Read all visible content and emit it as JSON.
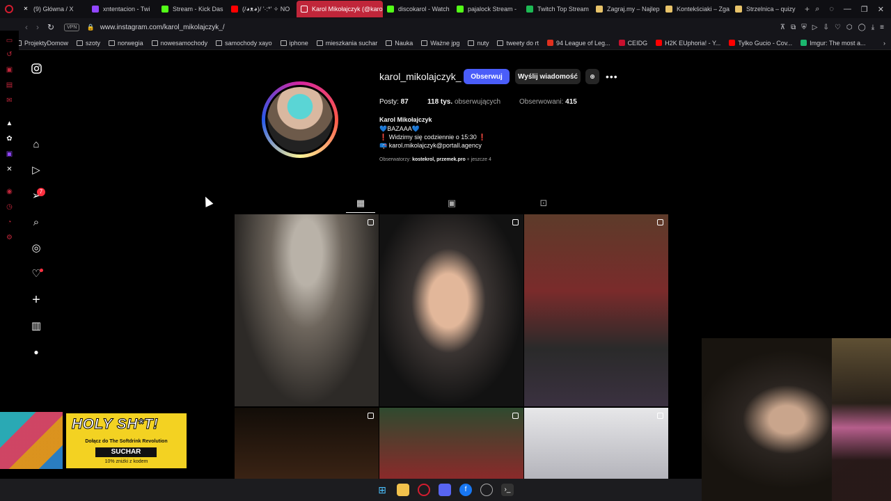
{
  "browser": {
    "tabs": [
      {
        "label": "(9) Główna / X",
        "icon": "x-icon",
        "color": "#ffffff"
      },
      {
        "label": "xntentacion - Twi",
        "icon": "twitch-icon",
        "color": "#9146ff"
      },
      {
        "label": "Stream - Kick Das",
        "icon": "kick-icon",
        "color": "#53fc18"
      },
      {
        "label": "(/◕ᴥ◕)/ '·:*' ✧ NO",
        "icon": "youtube-icon",
        "color": "#ff0000"
      },
      {
        "label": "Karol Mikołajczyk (@karo",
        "icon": "instagram-icon",
        "color": "#ffffff",
        "active": true
      },
      {
        "label": "discokarol - Watch",
        "icon": "kick-icon",
        "color": "#53fc18"
      },
      {
        "label": "pajalock Stream -",
        "icon": "kick-icon",
        "color": "#53fc18"
      },
      {
        "label": "Twitch Top Stream",
        "icon": "twitchtracker-icon",
        "color": "#1db954"
      },
      {
        "label": "Zagraj.my – Najlep",
        "icon": "trophy-icon",
        "color": "#e8c36a"
      },
      {
        "label": "Kontekściaki – Zga",
        "icon": "trophy-icon",
        "color": "#e8c36a"
      },
      {
        "label": "Strzelnica – quizy",
        "icon": "trophy-icon",
        "color": "#e8c36a"
      }
    ],
    "url": "www.instagram.com/karol_mikolajczyk_/",
    "vpn": "VPN",
    "bookmarks": [
      {
        "label": "ProjektyDomow",
        "type": "folder"
      },
      {
        "label": "szoty",
        "type": "folder"
      },
      {
        "label": "norwegia",
        "type": "folder"
      },
      {
        "label": "nowesamochody",
        "type": "folder"
      },
      {
        "label": "samochody xayo",
        "type": "folder"
      },
      {
        "label": "iphone",
        "type": "folder"
      },
      {
        "label": "mieszkania suchar",
        "type": "folder"
      },
      {
        "label": "Nauka",
        "type": "folder"
      },
      {
        "label": "Ważne jpg",
        "type": "folder"
      },
      {
        "label": "nuty",
        "type": "folder"
      },
      {
        "label": "tweety do rt",
        "type": "folder"
      },
      {
        "label": "94 League of Leg...",
        "type": "site",
        "color": "#e0301e"
      },
      {
        "label": "CEIDG",
        "type": "site",
        "color": "#c8102e"
      },
      {
        "label": "H2K EUphoria! - Y...",
        "type": "site",
        "color": "#ff0000"
      },
      {
        "label": "Tylko Gucio - Cov...",
        "type": "site",
        "color": "#ff0000"
      },
      {
        "label": "Imgur: The most a...",
        "type": "site",
        "color": "#1bb76e"
      }
    ]
  },
  "profile": {
    "username": "karol_mikolajczyk_",
    "follow_label": "Obserwuj",
    "message_label": "Wyślij wiadomość",
    "posts_count": "87",
    "posts_label": "Posty:",
    "followers_count": "118 tys.",
    "followers_label": "obserwujących",
    "following_label": "Obserwowani:",
    "following_count": "415",
    "full_name": "Karol Mikołajczyk",
    "bio": [
      "💙BAZAAA💙",
      "❗ Widzimy się codziennie o 15:30 ❗",
      "📪 karol.mikolajczyk@portall.agency"
    ],
    "followed_by_prefix": "Obserwatorzy:",
    "followed_by_names": "kostekrol, przemek.pro",
    "followed_by_suffix": "+ jeszcze 4"
  },
  "sidebar": {
    "notifications_badge": "7"
  },
  "overlay": {
    "ad_title": "HOLY SH*T!",
    "ad_subtitle": "Dołącz do The Softdrink Revolution",
    "ad_code": "SUCHAR",
    "ad_discount": "10% zniżki z kodem"
  },
  "colors": {
    "follow_button": "#4a5df9",
    "active_tab": "#c0263a",
    "badge": "#ff3040"
  }
}
